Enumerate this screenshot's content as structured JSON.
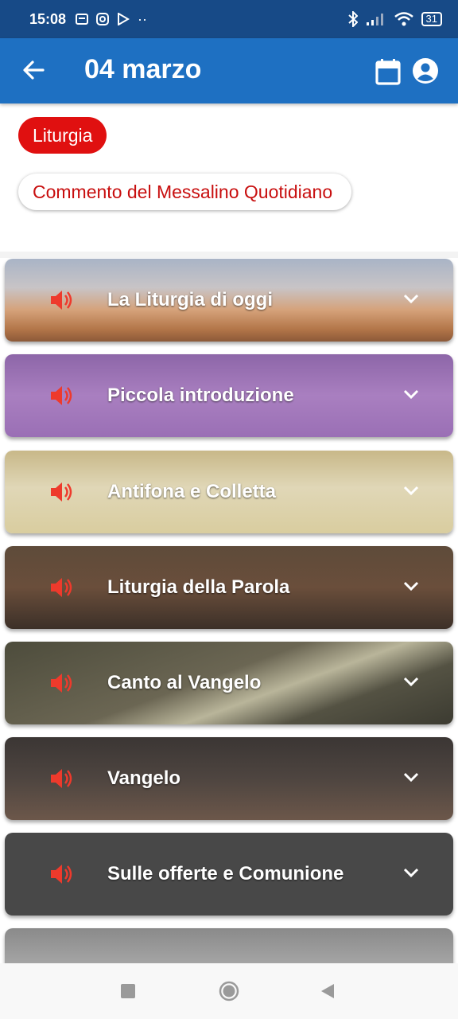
{
  "status_bar": {
    "time": "15:08",
    "battery": "31"
  },
  "app_bar": {
    "title": "04 marzo"
  },
  "chips": {
    "liturgia": "Liturgia",
    "commento": "Commento del Messalino Quotidiano"
  },
  "sections": [
    {
      "label": "La Liturgia di oggi"
    },
    {
      "label": "Piccola introduzione"
    },
    {
      "label": "Antifona e Colletta"
    },
    {
      "label": "Liturgia della Parola"
    },
    {
      "label": "Canto al Vangelo"
    },
    {
      "label": "Vangelo"
    },
    {
      "label": "Sulle offerte e Comunione"
    }
  ],
  "colors": {
    "status_bar": "#174a87",
    "app_bar": "#1e70c2",
    "accent_red": "#e01010"
  },
  "icons": [
    "arrow-left-icon",
    "calendar-icon",
    "account-circle-icon",
    "speaker-icon",
    "chevron-down-icon"
  ]
}
